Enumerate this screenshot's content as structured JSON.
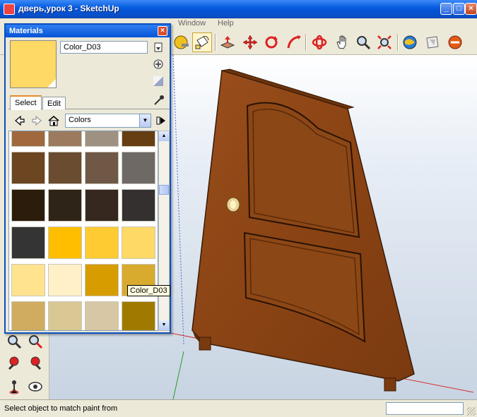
{
  "window": {
    "title": "дверь,урок 3 - SketchUp",
    "min": "_",
    "max": "□",
    "close": "×"
  },
  "menu": [
    "Window",
    "Help"
  ],
  "toolbar": {
    "icons": [
      "tape-measure-icon",
      "paint-bucket-icon",
      "push-pull-icon",
      "move-icon",
      "rotate-icon",
      "follow-me-icon",
      "orbit-icon",
      "pan-icon",
      "zoom-icon",
      "zoom-extents-icon",
      "get-models-icon",
      "share-model-icon",
      "layout-icon"
    ]
  },
  "materials": {
    "title": "Materials",
    "current_name": "Color_D03",
    "current_color": "#ffd966",
    "tabs": [
      "Select",
      "Edit"
    ],
    "library": "Colors",
    "tooltip": "Color_D03",
    "swatches": [
      [
        "#a0693d",
        "#9c7a5d",
        "#9f9182",
        "#663e12"
      ],
      [
        "#6b4621",
        "#6a4c31",
        "#6f5846",
        "#6f6966"
      ],
      [
        "#2c1c0b",
        "#2f2418",
        "#36281e",
        "#343030"
      ],
      [
        "#343434",
        "#ffbe00",
        "#ffcb33",
        "#ffd966"
      ],
      [
        "#ffe38f",
        "#fff0c7",
        "#d69c00",
        "#d8ab2e"
      ],
      [
        "#d0ac60",
        "#d9c893",
        "#d7c7a4",
        "#a07a00"
      ]
    ]
  },
  "status": {
    "text": "Select object to match paint from"
  }
}
